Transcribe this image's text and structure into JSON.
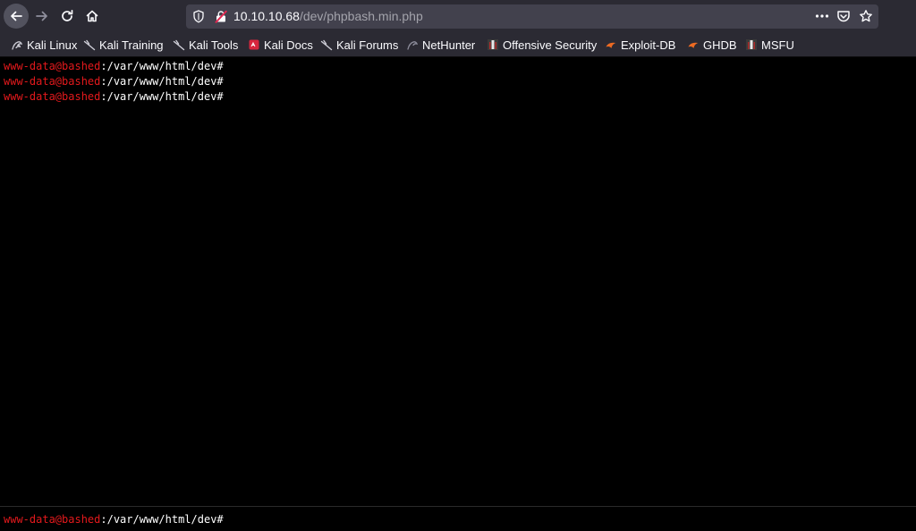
{
  "browser": {
    "url_host": "10.10.10.68",
    "url_path": "/dev/phpbash.min.php",
    "colors": {
      "toolbar": "#2b2a33",
      "urlbar": "#42414d",
      "text": "#fbfbfe"
    }
  },
  "bookmarks": [
    {
      "label": "Kali Linux",
      "icon": "kali-dragon-icon"
    },
    {
      "label": "Kali Training",
      "icon": "kali-dragon-icon"
    },
    {
      "label": "Kali Tools",
      "icon": "kali-dragon-icon"
    },
    {
      "label": "Kali Docs",
      "icon": "kali-docs-icon"
    },
    {
      "label": "Kali Forums",
      "icon": "kali-dragon-icon"
    },
    {
      "label": "NetHunter",
      "icon": "nethunter-icon"
    },
    {
      "label": "Offensive Security",
      "icon": "offsec-icon"
    },
    {
      "label": "Exploit-DB",
      "icon": "exploitdb-icon"
    },
    {
      "label": "GHDB",
      "icon": "exploitdb-icon"
    },
    {
      "label": "MSFU",
      "icon": "offsec-icon"
    }
  ],
  "terminal": {
    "prompt_user": "www-data@bashed",
    "prompt_path": ":/var/www/html/dev#",
    "lines": [
      {
        "user": "www-data@bashed",
        "path": ":/var/www/html/dev#"
      },
      {
        "user": "www-data@bashed",
        "path": ":/var/www/html/dev#"
      },
      {
        "user": "www-data@bashed",
        "path": ":/var/www/html/dev#"
      }
    ],
    "input_value": "",
    "colors": {
      "prompt_user": "#e3191c",
      "prompt_path": "#ffffff",
      "background": "#000000"
    }
  }
}
